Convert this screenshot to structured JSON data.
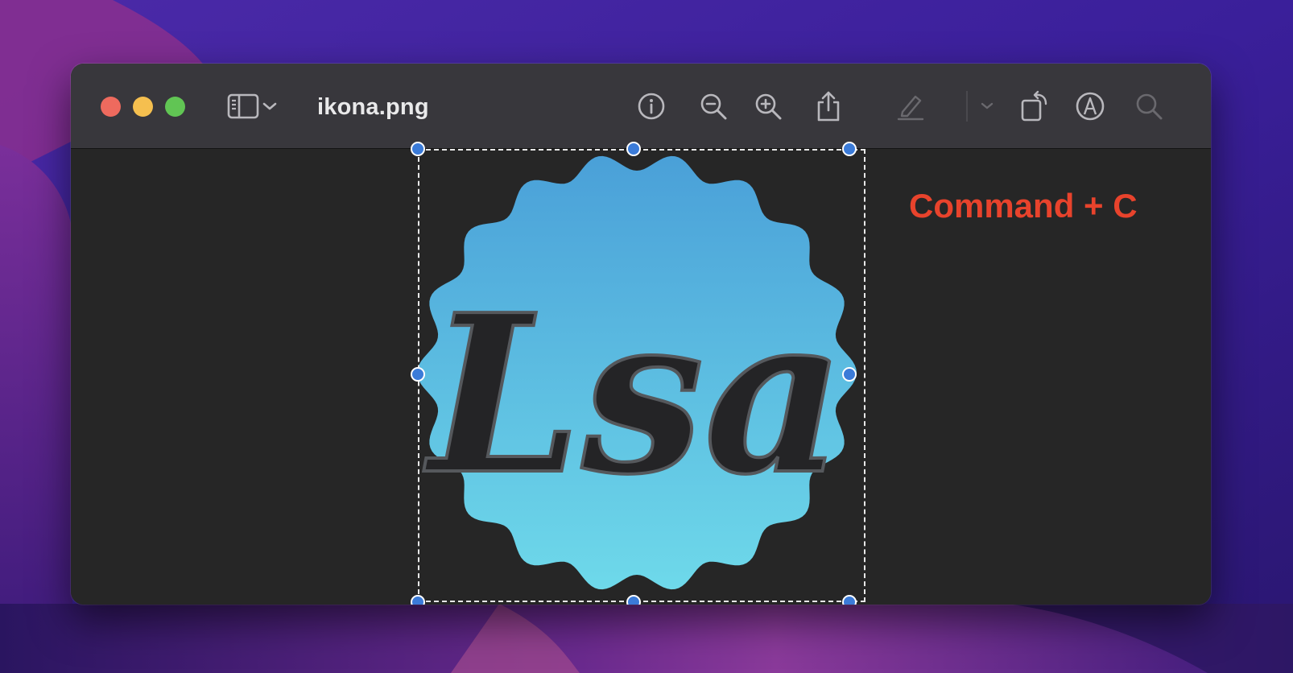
{
  "window": {
    "title": "ikona.png"
  },
  "toolbar": {
    "items": [
      {
        "name": "sidebar-toggle",
        "icon": "sidebar-icon"
      },
      {
        "name": "sidebar-menu",
        "icon": "chevron-down-icon"
      },
      {
        "name": "info",
        "icon": "info-icon"
      },
      {
        "name": "zoom-out",
        "icon": "zoom-out-icon"
      },
      {
        "name": "zoom-in",
        "icon": "zoom-in-icon"
      },
      {
        "name": "share",
        "icon": "share-icon"
      },
      {
        "name": "highlight",
        "icon": "highlighter-icon",
        "enabled": false
      },
      {
        "name": "highlight-menu",
        "icon": "chevron-down-icon",
        "enabled": false
      },
      {
        "name": "rotate",
        "icon": "rotate-icon"
      },
      {
        "name": "markup",
        "icon": "markup-icon"
      },
      {
        "name": "search",
        "icon": "search-icon",
        "enabled": false
      }
    ]
  },
  "image": {
    "logo_text": "Lsa",
    "badge_color_top": "#4aa0d8",
    "badge_color_bottom": "#6ed9ea"
  },
  "annotation": {
    "text": "Command + C",
    "color": "#e8432c"
  },
  "colors": {
    "titlebar": "#38373c",
    "canvas": "#262626",
    "selection_handle": "#3b7bd8"
  }
}
